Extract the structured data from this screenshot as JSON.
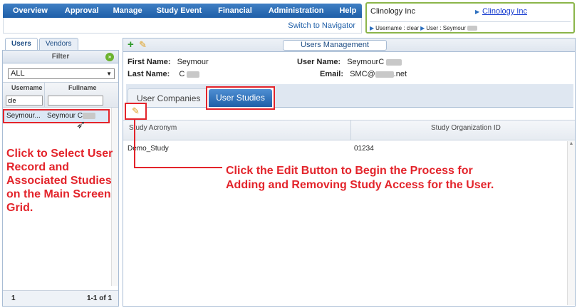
{
  "nav": {
    "items": [
      "Overview",
      "Approval",
      "Manage",
      "Study Event",
      "Financial",
      "Administration",
      "Help"
    ],
    "switch_label": "Switch to Navigator"
  },
  "info": {
    "company": "Clinology Inc",
    "company_link": "Clinology Inc",
    "crumb_username": "Username : clear",
    "crumb_user": "User : Seymour"
  },
  "left": {
    "tabs": [
      "Users",
      "Vendors"
    ],
    "filter_label": "Filter",
    "filter_value": "ALL",
    "col_username": "Username",
    "col_fullname": "Fullname",
    "username_filter": "cle",
    "row_username": "Seymour...",
    "row_fullname": "Seymour C",
    "annotation": "Click to Select User Record and Associated Studies on the Main Screen Grid.",
    "page": "1",
    "paging": "1-1 of 1"
  },
  "right": {
    "title": "Users Management",
    "first_name_label": "First Name:",
    "first_name_value": "Seymour",
    "last_name_label": "Last Name:",
    "last_name_value": "C",
    "user_name_label": "User Name:",
    "user_name_value": "SeymourC",
    "email_label": "Email:",
    "email_value": "SMC@",
    "email_suffix": ".net",
    "tab_companies": "User Companies",
    "tab_studies": "User Studies",
    "col_acronym": "Study Acronym",
    "col_org_id": "Study Organization ID",
    "row_acronym": "Demo_Study",
    "row_org_id": "01234",
    "annotation_line1": "Click the Edit Button to Begin the Process for",
    "annotation_line2": "Adding and Removing Study Access for the User."
  },
  "colors": {
    "accent": "#1f5fa8",
    "annotation": "#e3242b",
    "info_border": "#8bb54a"
  }
}
